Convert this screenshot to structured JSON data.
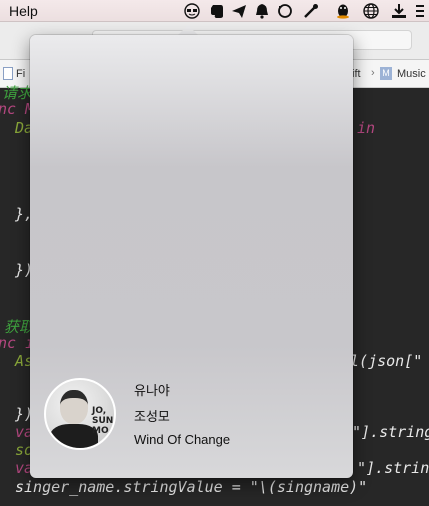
{
  "menubar": {
    "help_label": "Help",
    "tray_icons": [
      "cool-face-icon",
      "evernote-icon",
      "paper-plane-icon",
      "bell-icon",
      "sync-icon",
      "music-tool-icon",
      "penguin-icon",
      "globe-icon",
      "download-icon",
      "extra-icon"
    ]
  },
  "jumpbar": {
    "file_prefix": "Fi",
    "crumb": "ift",
    "group_badge": "M",
    "group_label": "Music"
  },
  "code": {
    "lines": [
      {
        "text": "请求",
        "color": "#3fa33f"
      },
      {
        "text": "nc M",
        "color": "#b3477f"
      },
      {
        "text": "Da",
        "color": "#8aa83a"
      },
      {
        "text": "in",
        "color": "#b3477f"
      },
      {
        "text": "},",
        "color": "#e8e8e8"
      },
      {
        "text": "})",
        "color": "#e8e8e8"
      },
      {
        "text": "获取",
        "color": "#3fa33f"
      },
      {
        "text": "nc i",
        "color": "#b3477f"
      },
      {
        "text": "As",
        "color": "#8aa83a"
      },
      {
        "text": "rl(json[\"",
        "color": "#e8e8e8"
      },
      {
        "text": "})",
        "color": "#e8e8e8"
      },
      {
        "text": "va",
        "color": "#b3477f"
      },
      {
        "text": "\"].string",
        "color": "#e8e8e8"
      },
      {
        "text": "so",
        "color": "#8aa83a"
      },
      {
        "text": "va",
        "color": "#b3477f"
      },
      {
        "text": "\"].strin",
        "color": "#e8e8e8"
      },
      {
        "text": "singer_name.stringValue = \"\\(singname)\"",
        "color": "#e8e8e8"
      }
    ]
  },
  "popover": {
    "artist_name": "유나야",
    "artist_alt": "조성모",
    "song_title": "Wind Of Change",
    "avatar_caption": "JO, SUNG MO"
  },
  "colors": {
    "menubar_bg": "#efe3e4",
    "code_bg": "#272727",
    "keyword": "#b3477f",
    "comment": "#3fa33f",
    "identifier": "#8aa83a"
  }
}
